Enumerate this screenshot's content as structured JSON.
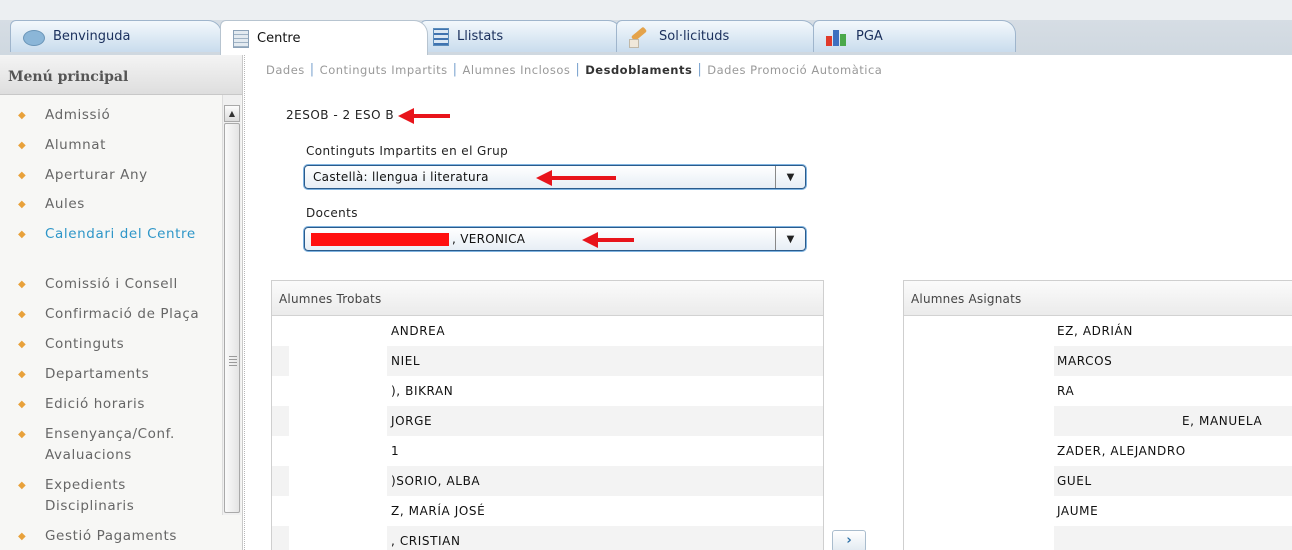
{
  "tabs": [
    {
      "label": "Benvinguda",
      "icon": "chat-bubble-icon"
    },
    {
      "label": "Centre",
      "icon": "grid-table-icon",
      "active": true
    },
    {
      "label": "Llistats",
      "icon": "list-document-icon"
    },
    {
      "label": "Sol·licituds",
      "icon": "pencil-icon"
    },
    {
      "label": "PGA",
      "icon": "bar-chart-icon"
    }
  ],
  "menu": {
    "title": "Menú principal",
    "items": [
      {
        "label": "Admissió"
      },
      {
        "label": "Alumnat"
      },
      {
        "label": "Aperturar Any"
      },
      {
        "label": "Aules"
      },
      {
        "label": "Calendari del Centre",
        "highlighted": true
      },
      {
        "label": "Comissió i Consell"
      },
      {
        "label": "Confirmació de Plaça"
      },
      {
        "label": "Continguts"
      },
      {
        "label": "Departaments"
      },
      {
        "label": "Edició horaris"
      },
      {
        "label": "Ensenyança/Conf.",
        "label2": "Avaluacions"
      },
      {
        "label": "Expedients",
        "label2": "Disciplinaris"
      },
      {
        "label": "Gestió Pagaments"
      }
    ]
  },
  "subnav": {
    "items": [
      "Dades",
      "Continguts Impartits",
      "Alumnes Inclosos",
      "Desdoblaments",
      "Dades Promoció Automàtica"
    ],
    "active": "Desdoblaments"
  },
  "group": {
    "label": "2ESOB - 2 ESO B"
  },
  "form": {
    "continguts_label": "Continguts Impartits en el Grup",
    "continguts_value": "Castellà: llengua i literatura",
    "docents_label": "Docents",
    "docents_value": ", VERONICA"
  },
  "alumnes_trobats": {
    "title": "Alumnes Trobats",
    "rows": [
      "ANDREA",
      "NIEL",
      "), BIKRAN",
      "JORGE",
      "1",
      ")SORIO, ALBA",
      "Z, MARÍA JOSÉ",
      ", CRISTIAN"
    ]
  },
  "alumnes_asignats": {
    "title": "Alumnes Asignats",
    "rows": [
      "EZ, ADRIÁN",
      "MARCOS",
      "RA",
      "E, MANUELA",
      "ZADER, ALEJANDRO",
      "GUEL",
      "JAUME",
      ""
    ]
  },
  "move_button": {
    "label": "›"
  },
  "colors": {
    "accent_red": "#e8141b",
    "highlight_blue": "#2e96c8",
    "menu_arrow": "#e8a13a"
  }
}
